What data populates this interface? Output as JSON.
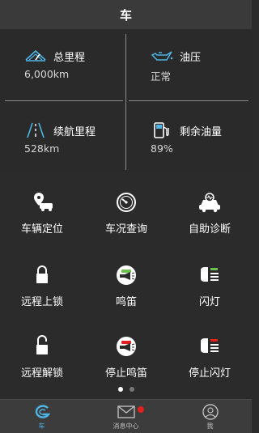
{
  "header": {
    "title": "车"
  },
  "stats": [
    {
      "label": "总里程",
      "value": "6,000km",
      "icon": "odometer-icon"
    },
    {
      "label": "油压",
      "value": "正常",
      "icon": "oil-pressure-icon"
    },
    {
      "label": "续航里程",
      "value": "528km",
      "icon": "range-road-icon"
    },
    {
      "label": "剩余油量",
      "value": "89%",
      "icon": "fuel-pump-icon"
    }
  ],
  "actions": [
    {
      "label": "车辆定位",
      "icon": "car-location-icon"
    },
    {
      "label": "车况查询",
      "icon": "gauge-icon"
    },
    {
      "label": "自助诊断",
      "icon": "car-diagnosis-icon"
    },
    {
      "label": "远程上锁",
      "icon": "lock-icon"
    },
    {
      "label": "鸣笛",
      "icon": "horn-icon"
    },
    {
      "label": "闪灯",
      "icon": "headlight-icon"
    },
    {
      "label": "远程解锁",
      "icon": "unlock-icon"
    },
    {
      "label": "停止鸣笛",
      "icon": "horn-stop-icon"
    },
    {
      "label": "停止闪灯",
      "icon": "headlight-stop-icon"
    }
  ],
  "pager": {
    "current": 1,
    "total": 2
  },
  "tabs": [
    {
      "label": "车",
      "icon": "car-tab-icon",
      "active": true
    },
    {
      "label": "消息中心",
      "icon": "envelope-icon",
      "active": false,
      "badge": true
    },
    {
      "label": "我",
      "icon": "profile-icon",
      "active": false
    }
  ],
  "colors": {
    "accent": "#4fb4e6",
    "badge": "#e3201b",
    "background": "#2b2b2b",
    "header": "#3a3a3a"
  }
}
